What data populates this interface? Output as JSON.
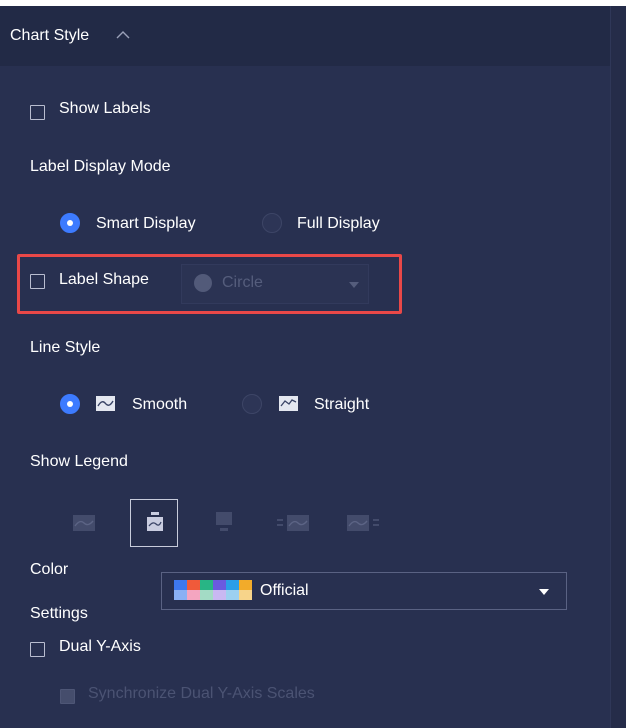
{
  "section": {
    "title": "Chart Style"
  },
  "show_labels": {
    "label": "Show Labels",
    "checked": false
  },
  "label_display_mode": {
    "title": "Label Display Mode",
    "options": [
      "Smart Display",
      "Full Display"
    ],
    "selected": "Smart Display"
  },
  "label_shape": {
    "label": "Label Shape",
    "checked": false,
    "value": "Circle"
  },
  "line_style": {
    "title": "Line Style",
    "options": [
      "Smooth",
      "Straight"
    ],
    "selected": "Smooth"
  },
  "show_legend": {
    "title": "Show Legend",
    "positions": [
      "none",
      "top",
      "bottom",
      "left",
      "right"
    ],
    "selected": "top"
  },
  "color_settings": {
    "title_line1": "Color",
    "title_line2": "Settings",
    "palette_name": "Official",
    "palette_colors": [
      "#3e78ee",
      "#f05a3a",
      "#28b585",
      "#6a5ae0",
      "#2a9ee8",
      "#f2ab2a",
      "#8ab0f4",
      "#f4a5c0",
      "#a3dbc5",
      "#c9b8f2",
      "#9cd0f0",
      "#f7d48a"
    ]
  },
  "dual_y_axis": {
    "label": "Dual Y-Axis",
    "checked": false
  },
  "sync_scales": {
    "label": "Synchronize Dual Y-Axis Scales",
    "checked": false,
    "disabled": true
  },
  "colors": {
    "panel_bg": "#283050",
    "header_bg": "#222a46",
    "accent": "#3d7bff",
    "highlight": "#e94848"
  }
}
